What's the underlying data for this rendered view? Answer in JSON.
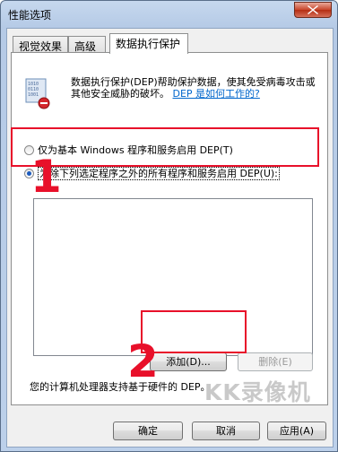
{
  "window": {
    "title": "性能选项"
  },
  "tabs": [
    {
      "label": "视觉效果"
    },
    {
      "label": "高级"
    },
    {
      "label": "数据执行保护"
    }
  ],
  "dep": {
    "description": "数据执行保护(DEP)帮助保护数据，使其免受病毒攻击或其他安全威胁的破坏。",
    "link": "DEP 是如何工作的?",
    "radio_basic": "仅为基本 Windows 程序和服务启用 DEP(T)",
    "radio_all": "为除下列选定程序之外的所有程序和服务启用 DEP(U):",
    "add_button": "添加(D)...",
    "remove_button": "删除(E)",
    "hardware_note": "您的计算机处理器支持基于硬件的 DEP。"
  },
  "footer": {
    "ok": "确定",
    "cancel": "取消",
    "apply": "应用(A)"
  },
  "annotations": {
    "mark1": "1",
    "mark2": "2",
    "accent_color": "#e8102a"
  },
  "watermark": "KK录像机"
}
